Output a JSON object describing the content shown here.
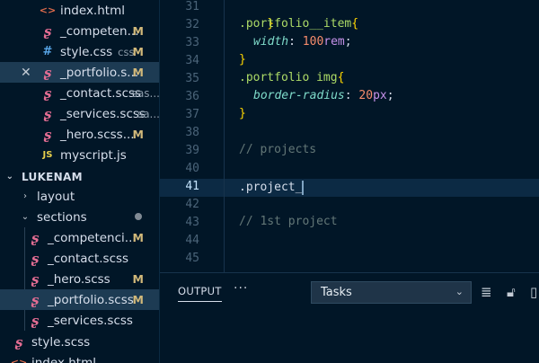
{
  "explorer": {
    "open_editors": [
      {
        "name": "index.html",
        "icon": "html-icon",
        "hint": "",
        "badge": ""
      },
      {
        "name": "_competen...",
        "icon": "sass-icon",
        "hint": "",
        "badge": "M"
      },
      {
        "name": "style.css",
        "icon": "css-icon",
        "hint": "css",
        "badge": "M"
      },
      {
        "name": "_portfolio.s...",
        "icon": "sass-icon",
        "hint": "",
        "badge": "M",
        "active": true
      },
      {
        "name": "_contact.scss",
        "icon": "sass-icon",
        "hint": "sas...",
        "badge": ""
      },
      {
        "name": "_services.scss",
        "icon": "sass-icon",
        "hint": "sa...",
        "badge": ""
      },
      {
        "name": "_hero.scss...",
        "icon": "sass-icon",
        "hint": "",
        "badge": "M"
      },
      {
        "name": "myscript.js",
        "icon": "js-icon",
        "hint": "",
        "badge": ""
      }
    ],
    "project_title": "LUKENAM",
    "tree": {
      "layout_folder": "layout",
      "sections_folder": "sections",
      "section_files": [
        {
          "name": "_competenci...",
          "badge": "M"
        },
        {
          "name": "_contact.scss",
          "badge": ""
        },
        {
          "name": "_hero.scss",
          "badge": "M"
        },
        {
          "name": "_portfolio.scss",
          "badge": "M",
          "active": true
        },
        {
          "name": "_services.scss",
          "badge": ""
        }
      ],
      "root_style": "style.scss",
      "root_index": "index.html"
    }
  },
  "editor": {
    "line_numbers": [
      "31",
      "32",
      "33",
      "34",
      "35",
      "36",
      "37",
      "38",
      "39",
      "40",
      "41",
      "42",
      "43",
      "44",
      "45"
    ],
    "current_line": "41",
    "code": {
      "l31_brace": "}",
      "l32_sel": ".portfolio__item",
      "l32_brace": "{",
      "l33_prop": "width",
      "l33_colon": ": ",
      "l33_num": "100",
      "l33_unit": "rem",
      "l33_semi": ";",
      "l34_brace": "}",
      "l35_sel": ".portfolio img",
      "l35_brace": "{",
      "l36_prop": "border-radius",
      "l36_colon": ": ",
      "l36_num": "20",
      "l36_unit": "px",
      "l36_semi": ";",
      "l37_brace": "}",
      "l39_comment": "// projects",
      "l41_text": ".project_",
      "l43_comment": "// 1st project"
    }
  },
  "panel": {
    "tab_output": "OUTPUT",
    "more": "···",
    "task_select": "Tasks"
  }
}
